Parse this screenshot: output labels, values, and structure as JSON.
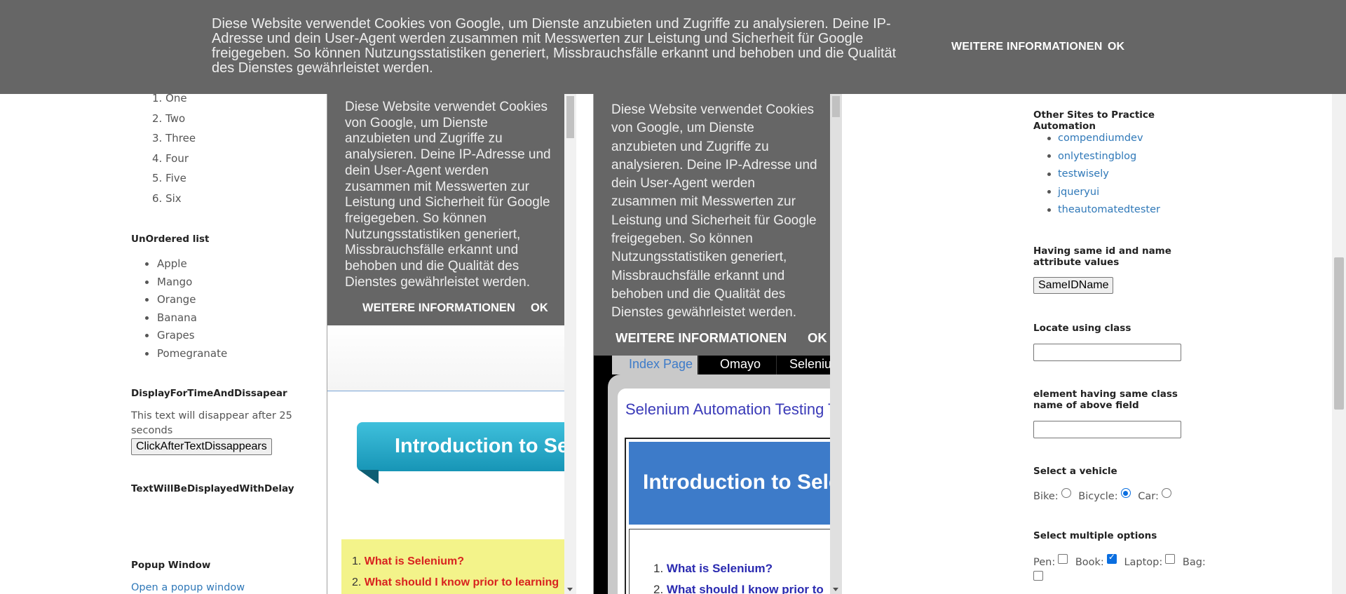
{
  "cookie_banner": {
    "message": "Diese Website verwendet Cookies von Google, um Dienste anzubieten und Zugriffe zu analysieren. Deine IP-Adresse und dein User-Agent werden zusammen mit Messwerten zur Leistung und Sicherheit für Google freigegeben. So können Nutzungsstatistiken generiert, Missbrauchsfälle erkannt und behoben und die Qualität des Dienstes gewährleistet werden.",
    "more_label": "WEITERE INFORMATIONEN",
    "ok_label": "OK"
  },
  "left": {
    "ordered_list": [
      "One",
      "Two",
      "Three",
      "Four",
      "Five",
      "Six"
    ],
    "ordered_numbers": [
      "1.",
      "2.",
      "3.",
      "4.",
      "5.",
      "6."
    ],
    "unordered_title": "UnOrdered list",
    "unordered_list": [
      "Apple",
      "Mango",
      "Orange",
      "Banana",
      "Grapes",
      "Pomegranate"
    ],
    "display_title": "DisplayForTimeAndDissapear",
    "display_text": "This text will disappear after 25 seconds",
    "click_button": "ClickAfterTextDissappears",
    "delay_title": "TextWillBeDisplayedWithDelay",
    "popup_title": "Popup Window",
    "popup_link": "Open a popup window"
  },
  "frame1": {
    "cookie_message": "Diese Website verwendet Cookies von Google, um Dienste anzubieten und Zugriffe zu analysieren. Deine IP-Adresse und dein User-Agent werden zusammen mit Messwerten zur Leistung und Sicherheit für Google freigegeben. So können Nutzungsstatistiken generiert, Missbrauchsfälle erkannt und behoben und die Qualität des Dienstes gewährleistet werden.",
    "more_label": "WEITERE INFORMATIONEN",
    "ok_label": "OK",
    "banner_text": "Introduction to Se",
    "list": [
      {
        "num": "1.",
        "text": "What is Selenium?"
      },
      {
        "num": "2.",
        "text": "What should I know prior to learning"
      }
    ]
  },
  "frame2": {
    "cookie_message": "Diese Website verwendet Cookies von Google, um Dienste anzubieten und Zugriffe zu analysieren. Deine IP-Adresse und dein User-Agent werden zusammen mit Messwerten zur Leistung und Sicherheit für Google freigegeben. So können Nutzungsstatistiken generiert, Missbrauchsfälle erkannt und behoben und die Qualität des Dienstes gewährleistet werden.",
    "more_label": "WEITERE INFORMATIONEN",
    "ok_label": "OK",
    "tabs": [
      "Index Page",
      "Omayo",
      "Seleniu"
    ],
    "title": "Selenium Automation Testing T",
    "banner_text": "Introduction to Sele",
    "list": [
      {
        "num": "1.",
        "text": "What is Selenium?"
      },
      {
        "num": "2.",
        "text": "What should I know prior to"
      }
    ]
  },
  "right": {
    "sites_title": "Other Sites to Practice Automation",
    "sites": [
      "compendiumdev",
      "onlytestingblog",
      "testwisely",
      "jqueryui",
      "theautomatedtester"
    ],
    "same_id_title": "Having same id and name attribute values",
    "same_id_button": "SameIDName",
    "locate_class_title": "Locate using class",
    "same_class_title": "element having same class name of above field",
    "vehicle_title": "Select a vehicle",
    "vehicles": [
      {
        "label": "Bike:",
        "checked": false
      },
      {
        "label": "Bicycle:",
        "checked": true
      },
      {
        "label": "Car:",
        "checked": false
      }
    ],
    "multi_title": "Select multiple options",
    "options": [
      {
        "label": "Pen:",
        "checked": false
      },
      {
        "label": "Book:",
        "checked": true
      },
      {
        "label": "Laptop:",
        "checked": false
      },
      {
        "label": "Bag:",
        "checked": false
      }
    ]
  },
  "colors": {
    "cookie_bg": "#666666",
    "link": "#2f78b8",
    "accent": "#0a6ee0"
  }
}
